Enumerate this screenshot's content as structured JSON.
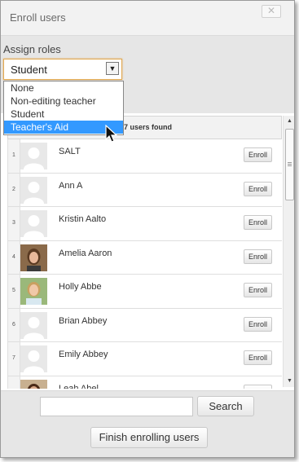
{
  "dialog": {
    "title": "Enroll users",
    "close_icon": "close-icon"
  },
  "roles": {
    "label": "Assign roles",
    "selected": "Student",
    "options": [
      "None",
      "Non-editing teacher",
      "Student",
      "Teacher's Aid"
    ],
    "highlighted_index": 3
  },
  "list": {
    "header": "7 users found",
    "users": [
      {
        "num": "1",
        "name": "SALT",
        "avatar": "default",
        "enroll": "Enroll"
      },
      {
        "num": "2",
        "name": "Ann A",
        "avatar": "default",
        "enroll": "Enroll"
      },
      {
        "num": "3",
        "name": "Kristin Aalto",
        "avatar": "default",
        "enroll": "Enroll"
      },
      {
        "num": "4",
        "name": "Amelia Aaron",
        "avatar": "photo",
        "enroll": "Enroll"
      },
      {
        "num": "5",
        "name": "Holly Abbe",
        "avatar": "photo",
        "enroll": "Enroll"
      },
      {
        "num": "6",
        "name": "Brian Abbey",
        "avatar": "default",
        "enroll": "Enroll"
      },
      {
        "num": "7",
        "name": "Emily Abbey",
        "avatar": "default",
        "enroll": "Enroll"
      },
      {
        "num": "",
        "name": "Leah Abel",
        "avatar": "photo",
        "enroll": "Enroll"
      }
    ]
  },
  "search": {
    "value": "",
    "button": "Search"
  },
  "finish_label": "Finish enrolling users",
  "colors": {
    "selected_option_bg": "#3399ff",
    "select_border": "#e0a850"
  }
}
